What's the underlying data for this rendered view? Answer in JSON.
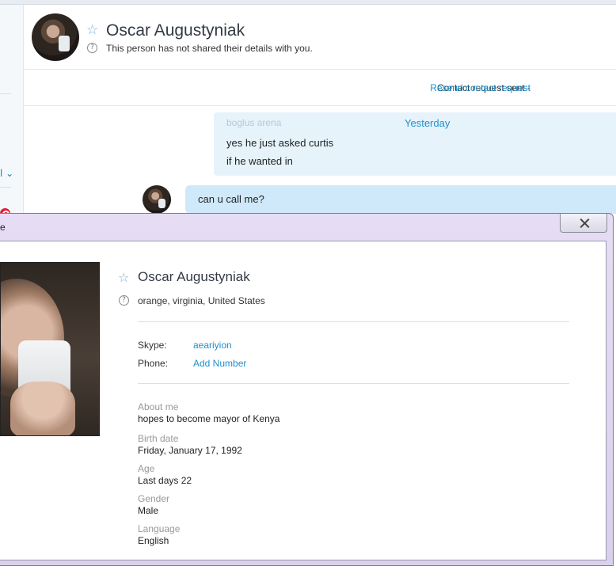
{
  "header": {
    "contact_name": "Oscar Augustyniak",
    "privacy_note": "This person has not shared their details with you.",
    "help_glyph": "?",
    "star_glyph": "☆"
  },
  "request_bar": {
    "status_text": "Contact request sent -",
    "resend_link": "Resend contact request"
  },
  "conversation": {
    "faded_sender": "boglus arena",
    "day_divider": "Yesterday",
    "messages": [
      "yes he just asked curtis",
      "if he wanted in",
      "can u call me?"
    ]
  },
  "sidebar": {
    "chevron_glyph": "l ⌄"
  },
  "dialog": {
    "title_fragment": "e",
    "profile": {
      "name": "Oscar Augustyniak",
      "location": "orange, virginia, United States",
      "star_glyph": "☆",
      "help_glyph": "?",
      "skype_label": "Skype:",
      "skype_value": "aeariyion",
      "phone_label": "Phone:",
      "phone_action": "Add Number",
      "about_label": "About me",
      "about_value": "hopes to become mayor of Kenya",
      "birth_label": "Birth date",
      "birth_value": "Friday, January 17, 1992",
      "age_label": "Age",
      "age_value": "Last days 22",
      "gender_label": "Gender",
      "gender_value": "Male",
      "language_label": "Language",
      "language_value": "English"
    }
  },
  "colors": {
    "link": "#1f8fcf",
    "bubble_in": "#e6f3fb",
    "bubble_active": "#cfe9fa",
    "dialog_frame": "#e6ddf4",
    "badge": "#e01e37"
  }
}
